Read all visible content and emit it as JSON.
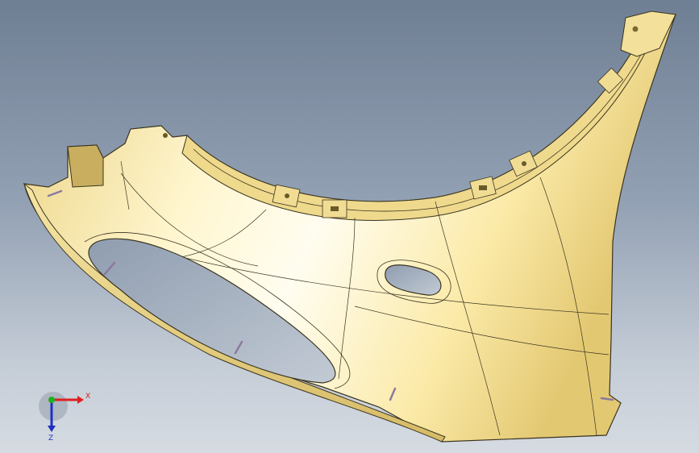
{
  "viewport": {
    "background_top": "#6f7f93",
    "background_bottom": "#d6dbe2",
    "part_color": "#f5e6a8",
    "part_highlight": "#fffbe6",
    "part_shadow": "#d9c071",
    "edge_color": "#3a3420"
  },
  "triad": {
    "x_label": "X",
    "z_label": "Z",
    "x_color": "#e02020",
    "y_color": "#20b020",
    "z_color": "#2030c0"
  }
}
